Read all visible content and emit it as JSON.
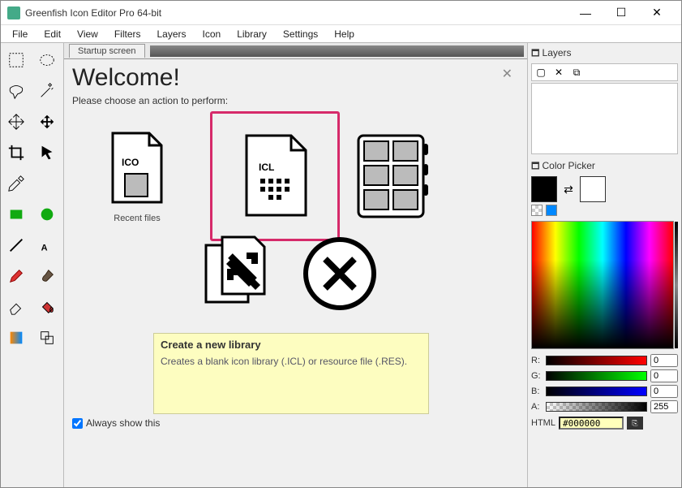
{
  "titlebar": {
    "title": "Greenfish Icon Editor Pro 64-bit"
  },
  "menu": [
    "File",
    "Edit",
    "View",
    "Filters",
    "Layers",
    "Icon",
    "Library",
    "Settings",
    "Help"
  ],
  "tab": {
    "label": "Startup screen"
  },
  "welcome": {
    "heading": "Welcome!",
    "prompt": "Please choose an action to perform:",
    "recent": "Recent files",
    "always": "Always show this",
    "ico": "ICO",
    "icl": "ICL",
    "hint_title": "Create a new library",
    "hint_desc": "Creates a blank icon library (.ICL) or resource file (.RES)."
  },
  "layers": {
    "header": "Layers"
  },
  "picker": {
    "header": "Color Picker",
    "r": "R:",
    "g": "G:",
    "b": "B:",
    "a": "A:",
    "rv": "0",
    "gv": "0",
    "bv": "0",
    "av": "255",
    "html_label": "HTML",
    "html_value": "#000000"
  }
}
